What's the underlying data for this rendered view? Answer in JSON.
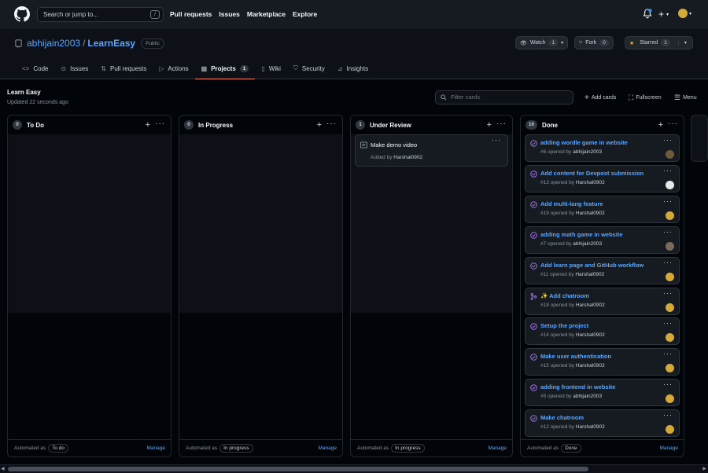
{
  "topbar": {
    "search_placeholder": "Search or jump to...",
    "search_shortcut": "/",
    "nav": [
      "Pull requests",
      "Issues",
      "Marketplace",
      "Explore"
    ],
    "plus_label": "+"
  },
  "repo": {
    "owner": "abhijain2003",
    "separator": "/",
    "name": "LearnEasy",
    "visibility": "Public",
    "watch_label": "Watch",
    "watch_count": "1",
    "fork_label": "Fork",
    "fork_count": "0",
    "star_label": "Starred",
    "star_count": "1"
  },
  "tabs": [
    {
      "label": "Code",
      "icon": "code-icon"
    },
    {
      "label": "Issues",
      "icon": "issue-icon"
    },
    {
      "label": "Pull requests",
      "icon": "pull-request-icon"
    },
    {
      "label": "Actions",
      "icon": "play-icon"
    },
    {
      "label": "Projects",
      "icon": "table-icon",
      "count": "1",
      "active": true
    },
    {
      "label": "Wiki",
      "icon": "book-icon"
    },
    {
      "label": "Security",
      "icon": "shield-icon"
    },
    {
      "label": "Insights",
      "icon": "graph-icon"
    }
  ],
  "project": {
    "title": "Learn Easy",
    "updated": "Updated 22 seconds ago",
    "filter_placeholder": "Filter cards",
    "add_cards": "Add cards",
    "fullscreen": "Fullscreen",
    "menu": "Menu"
  },
  "columns": [
    {
      "count": "0",
      "name": "To Do",
      "automated": "Automated as",
      "state": "To do",
      "manage": "Manage"
    },
    {
      "count": "0",
      "name": "In Progress",
      "automated": "Automated as",
      "state": "In progress",
      "manage": "Manage"
    },
    {
      "count": "1",
      "name": "Under Review",
      "automated": "Automated as",
      "state": "In progress",
      "manage": "Manage",
      "note": {
        "title": "Make demo video",
        "added_by_prefix": "Added by",
        "added_by": "Harshal0902"
      }
    },
    {
      "count": "10",
      "name": "Done",
      "automated": "Automated as",
      "state": "Done",
      "manage": "Manage"
    }
  ],
  "done_cards": [
    {
      "title": "adding wordle game in website",
      "number": "#6 opened by",
      "author": "abhijain2003",
      "icon": "issue-closed-icon"
    },
    {
      "title": "Add content for Devpost submission",
      "number": "#13 opened by",
      "author": "Harshal0902",
      "icon": "issue-closed-icon"
    },
    {
      "title": "Add multi-lang feature",
      "number": "#19 opened by",
      "author": "Harshal0902",
      "icon": "issue-closed-icon"
    },
    {
      "title": "adding math game in website",
      "number": "#7 opened by",
      "author": "abhijain2003",
      "icon": "issue-closed-icon"
    },
    {
      "title": "Add learn page and GitHub workflow",
      "number": "#11 opened by",
      "author": "Harshal0902",
      "icon": "issue-closed-icon"
    },
    {
      "title": "✨ Add chatroom",
      "number": "#18 opened by",
      "author": "Harshal0902",
      "icon": "merged-pr-icon"
    },
    {
      "title": "Setup the project",
      "number": "#14 opened by",
      "author": "Harshal0902",
      "icon": "issue-closed-icon"
    },
    {
      "title": "Make user authentication",
      "number": "#15 opened by",
      "author": "Harshal0902",
      "icon": "issue-closed-icon"
    },
    {
      "title": "adding frontend in website",
      "number": "#5 opened by",
      "author": "abhijain2003",
      "icon": "issue-closed-icon"
    },
    {
      "title": "Make chatroom",
      "number": "#12 opened by",
      "author": "Harshal0902",
      "icon": "issue-closed-icon"
    }
  ],
  "colors": {
    "accent": "#58a6ff",
    "closed": "#a371f7",
    "bg": "#010409",
    "tab_underline": "#f78166"
  }
}
